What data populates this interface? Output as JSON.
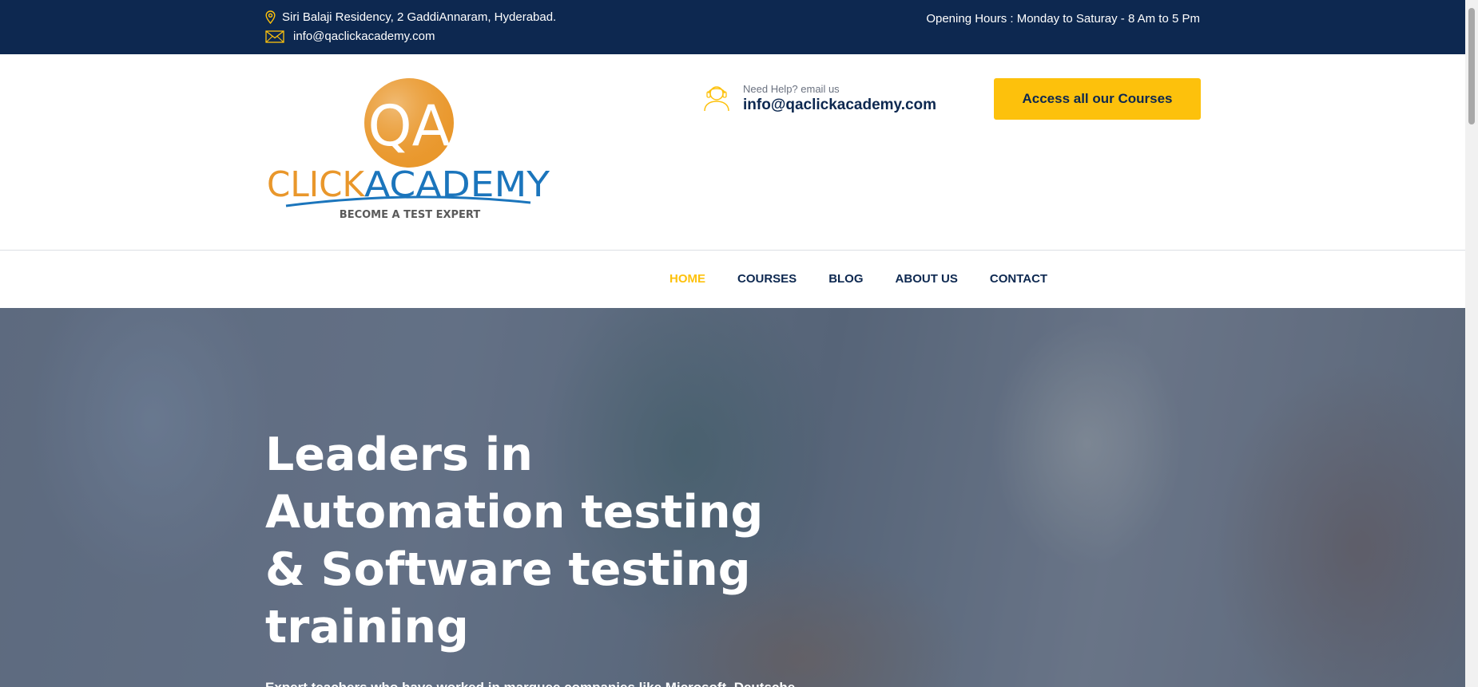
{
  "topbar": {
    "address": "Siri Balaji Residency, 2 GaddiAnnaram, Hyderabad.",
    "email": "info@qaclickacademy.com",
    "hours": "Opening Hours : Monday to Saturay - 8 Am to 5 Pm",
    "icons": [
      "map-pin-icon",
      "envelope-icon"
    ]
  },
  "header": {
    "logo": {
      "top_text": "QA",
      "main_text_left": "CLICK",
      "main_text_right": "ACADEMY",
      "tagline": "BECOME A TEST EXPERT"
    },
    "help_small": "Need Help? email us",
    "help_email": "info@qaclickacademy.com",
    "cta_label": "Access all our Courses"
  },
  "nav": {
    "items": [
      {
        "label": "HOME",
        "active": true
      },
      {
        "label": "COURSES",
        "active": false
      },
      {
        "label": "BLOG",
        "active": false
      },
      {
        "label": "ABOUT US",
        "active": false
      },
      {
        "label": "CONTACT",
        "active": false
      }
    ]
  },
  "hero": {
    "title_lines": [
      "Leaders in",
      "Automation testing",
      "& Software testing",
      "training"
    ],
    "subtitle": "Expert teachers who have worked in marquee companies like Microsoft, Deutsche"
  },
  "colors": {
    "navy": "#0d2850",
    "accent": "#fdc10c",
    "logo_orange": "#e9972b",
    "logo_blue": "#1b75bc"
  }
}
